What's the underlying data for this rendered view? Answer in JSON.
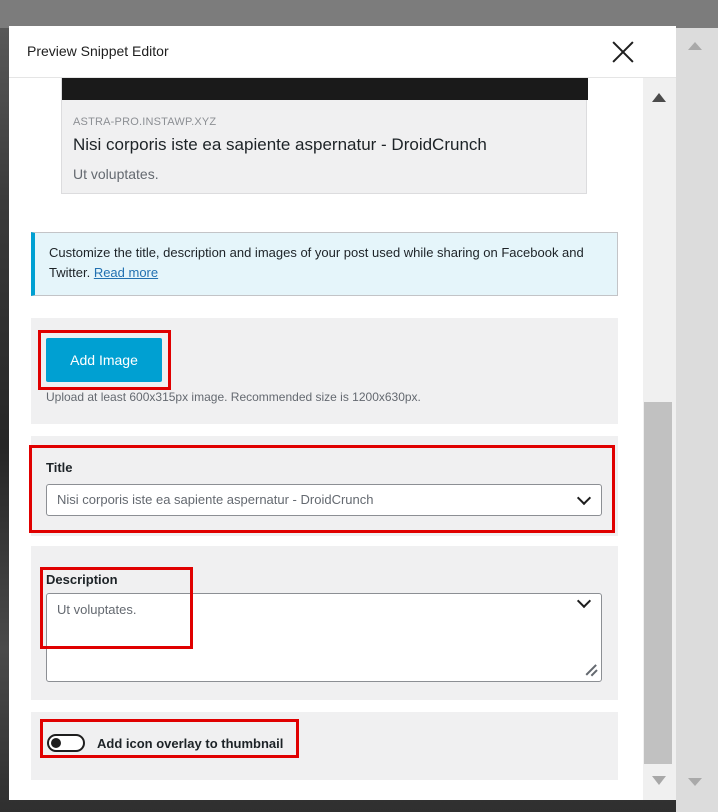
{
  "window": {
    "title": "Preview Snippet Editor"
  },
  "preview": {
    "domain": "ASTRA-PRO.INSTAWP.XYZ",
    "title": "Nisi corporis iste ea sapiente aspernatur - DroidCrunch",
    "description": "Ut voluptates."
  },
  "notice": {
    "text": "Customize the title, description and images of your post used while sharing on Facebook and Twitter.",
    "link_label": "Read more"
  },
  "image": {
    "button_label": "Add Image",
    "hint": "Upload at least 600x315px image. Recommended size is 1200x630px."
  },
  "title_field": {
    "label": "Title",
    "value": "Nisi corporis iste ea sapiente aspernatur - DroidCrunch"
  },
  "description_field": {
    "label": "Description",
    "value": "Ut voluptates."
  },
  "toggle": {
    "label": "Add icon overlay to thumbnail",
    "checked": false
  },
  "colors": {
    "accent": "#00a0d2",
    "highlight": "#e00000",
    "notice_bg": "#e5f5fa"
  }
}
